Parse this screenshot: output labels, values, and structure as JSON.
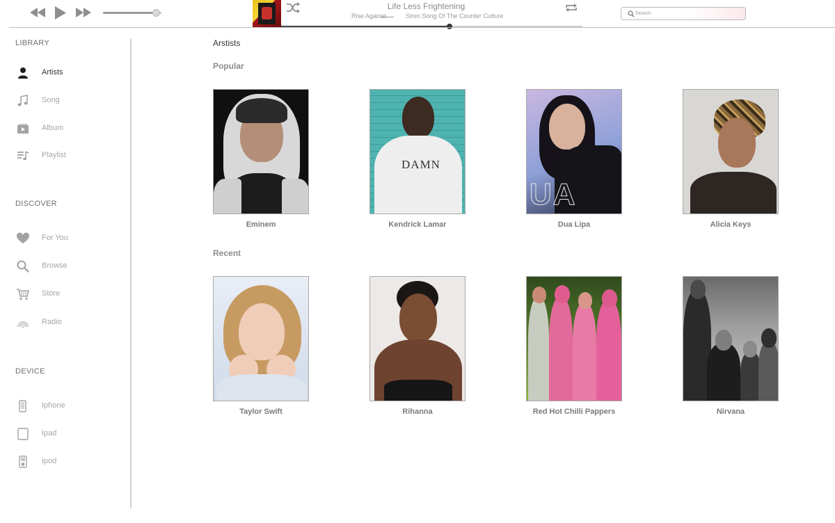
{
  "player": {
    "now_playing": {
      "title": "Life Less Frightening",
      "artist": "Rise Against",
      "song": "Siren Song Of The Counter Culture"
    },
    "progress": 0.56,
    "volume": 0.9
  },
  "search": {
    "placeholder": "Search"
  },
  "sidebar": {
    "library": {
      "title": "LIBRARY",
      "items": [
        {
          "label": "Artists",
          "icon": "person-icon",
          "active": true
        },
        {
          "label": "Song",
          "icon": "music-note-icon",
          "active": false
        },
        {
          "label": "Album",
          "icon": "album-icon",
          "active": false
        },
        {
          "label": "Playlist",
          "icon": "playlist-icon",
          "active": false
        }
      ]
    },
    "discover": {
      "title": "DISCOVER",
      "items": [
        {
          "label": "For You",
          "icon": "heart-icon"
        },
        {
          "label": "Browse",
          "icon": "search-icon"
        },
        {
          "label": "Store",
          "icon": "cart-icon"
        },
        {
          "label": "Radio",
          "icon": "radio-icon"
        }
      ]
    },
    "device": {
      "title": "DEVICE",
      "items": [
        {
          "label": "Iphone",
          "icon": "phone-icon"
        },
        {
          "label": "Ipad",
          "icon": "tablet-icon"
        },
        {
          "label": "Ipod",
          "icon": "ipod-icon"
        }
      ]
    }
  },
  "main": {
    "title": "Arstists",
    "popular": {
      "title": "Popular",
      "artists": [
        {
          "name": "Eminem"
        },
        {
          "name": "Kendrick Lamar"
        },
        {
          "name": "Dua Lipa"
        },
        {
          "name": "Alicia Keys"
        }
      ]
    },
    "recent": {
      "title": "Recent",
      "artists": [
        {
          "name": "Taylor Swift"
        },
        {
          "name": "Rihanna"
        },
        {
          "name": "Red Hot Chilli Pappers"
        },
        {
          "name": "Nirvana"
        }
      ]
    }
  }
}
